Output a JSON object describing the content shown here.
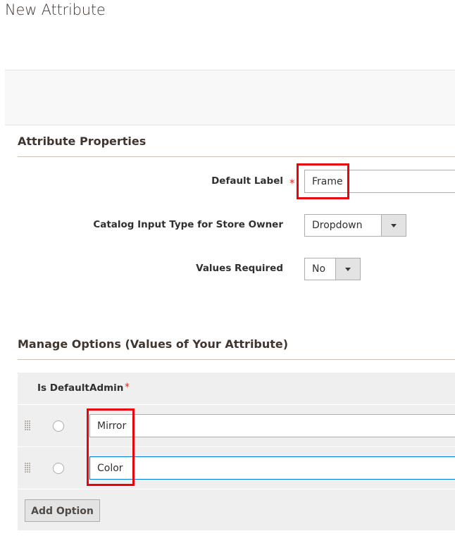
{
  "page": {
    "title": "New Attribute"
  },
  "attribute_properties": {
    "section_title": "Attribute Properties",
    "default_label": {
      "label": "Default Label",
      "required_mark": "*",
      "value": "Frame"
    },
    "catalog_input_type": {
      "label": "Catalog Input Type for Store Owner",
      "value": "Dropdown"
    },
    "values_required": {
      "label": "Values Required",
      "value": "No"
    }
  },
  "manage_options": {
    "section_title": "Manage Options (Values of Your Attribute)",
    "columns": {
      "is_default": "Is Default",
      "admin": "Admin",
      "required_mark": "*"
    },
    "rows": [
      {
        "value": "Mirror",
        "is_default": false,
        "focused": false
      },
      {
        "value": "Color",
        "is_default": false,
        "focused": true
      }
    ],
    "add_option_label": "Add Option"
  },
  "icons": {
    "drag": "drag-handle-icon",
    "dropdown": "chevron-down-icon"
  },
  "colors": {
    "required": "#e22626",
    "highlight": "#e8030d",
    "focus": "#007bdb"
  }
}
